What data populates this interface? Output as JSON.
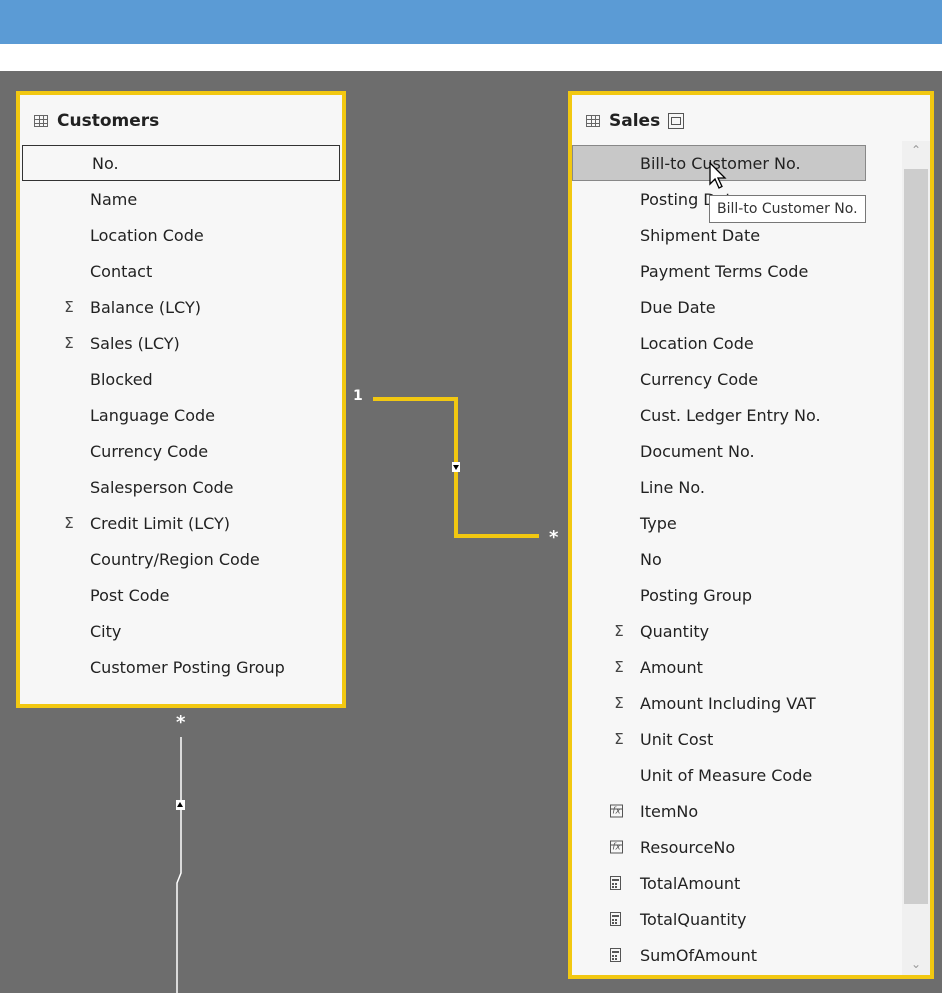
{
  "customers": {
    "title": "Customers",
    "fields": [
      {
        "label": "No.",
        "icon": "",
        "focused": true
      },
      {
        "label": "Name",
        "icon": ""
      },
      {
        "label": "Location Code",
        "icon": ""
      },
      {
        "label": "Contact",
        "icon": ""
      },
      {
        "label": "Balance (LCY)",
        "icon": "sigma-icon"
      },
      {
        "label": "Sales (LCY)",
        "icon": "sigma-icon"
      },
      {
        "label": "Blocked",
        "icon": ""
      },
      {
        "label": "Language Code",
        "icon": ""
      },
      {
        "label": "Currency Code",
        "icon": ""
      },
      {
        "label": "Salesperson Code",
        "icon": ""
      },
      {
        "label": "Credit Limit (LCY)",
        "icon": "sigma-icon"
      },
      {
        "label": "Country/Region Code",
        "icon": ""
      },
      {
        "label": "Post Code",
        "icon": ""
      },
      {
        "label": "City",
        "icon": ""
      },
      {
        "label": "Customer Posting Group",
        "icon": ""
      }
    ]
  },
  "sales": {
    "title": "Sales",
    "fields": [
      {
        "label": "Bill-to Customer No.",
        "icon": "",
        "selected": true
      },
      {
        "label": "Posting Date",
        "icon": ""
      },
      {
        "label": "Shipment Date",
        "icon": ""
      },
      {
        "label": "Payment Terms Code",
        "icon": ""
      },
      {
        "label": "Due Date",
        "icon": ""
      },
      {
        "label": "Location Code",
        "icon": ""
      },
      {
        "label": "Currency Code",
        "icon": ""
      },
      {
        "label": "Cust. Ledger Entry No.",
        "icon": ""
      },
      {
        "label": "Document No.",
        "icon": ""
      },
      {
        "label": "Line No.",
        "icon": ""
      },
      {
        "label": "Type",
        "icon": ""
      },
      {
        "label": "No",
        "icon": ""
      },
      {
        "label": "Posting Group",
        "icon": ""
      },
      {
        "label": "Quantity",
        "icon": "sigma-icon"
      },
      {
        "label": "Amount",
        "icon": "sigma-icon"
      },
      {
        "label": "Amount Including VAT",
        "icon": "sigma-icon"
      },
      {
        "label": "Unit Cost",
        "icon": "sigma-icon"
      },
      {
        "label": "Unit of Measure Code",
        "icon": ""
      },
      {
        "label": "ItemNo",
        "icon": "calculated-column-icon"
      },
      {
        "label": "ResourceNo",
        "icon": "calculated-column-icon"
      },
      {
        "label": "TotalAmount",
        "icon": "measure-icon"
      },
      {
        "label": "TotalQuantity",
        "icon": "measure-icon"
      },
      {
        "label": "SumOfAmount",
        "icon": "measure-icon"
      }
    ]
  },
  "tooltip": "Bill-to Customer No.",
  "relationships": {
    "customers_sales": {
      "one_label": "1",
      "many_label": "*"
    },
    "customers_down": {
      "many_label": "*"
    }
  },
  "colors": {
    "accent": "#f2c811",
    "header_bar": "#5b9bd5",
    "canvas": "#6d6d6d"
  }
}
